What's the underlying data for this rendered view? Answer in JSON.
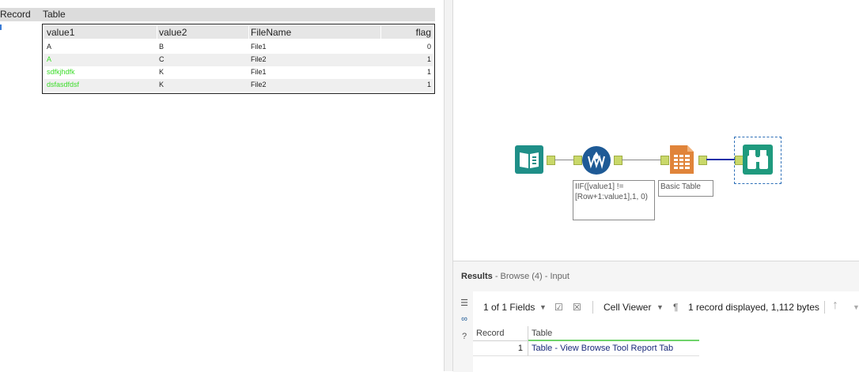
{
  "report": {
    "header": {
      "record": "Record",
      "table": "Table"
    },
    "columns": [
      "value1",
      "value2",
      "FileName",
      "flag"
    ],
    "rows": [
      {
        "value1": "A",
        "value2": "B",
        "filename": "File1",
        "flag": "0"
      },
      {
        "value1": "A",
        "value2": "C",
        "filename": "File2",
        "flag": "1"
      },
      {
        "value1": "sdfkjhdfk",
        "value2": "K",
        "filename": "File1",
        "flag": "1"
      },
      {
        "value1": "dsfasdfdsf",
        "value2": "K",
        "filename": "File2",
        "flag": "1"
      }
    ]
  },
  "workflow": {
    "formula_label": "IIF([value1] != [Row+1:value1],1, 0)",
    "table_label": "Basic Table",
    "tools": [
      "input-data-icon",
      "multi-row-formula-icon",
      "basic-table-icon",
      "browse-icon"
    ]
  },
  "results": {
    "title": "Results",
    "subtitle": "- Browse (4) - Input",
    "fields_label": "1 of 1 Fields",
    "cell_viewer_label": "Cell Viewer",
    "pilcrow": "¶",
    "status": "1 record displayed, 1,112 bytes",
    "grid": {
      "headers": {
        "record": "Record",
        "table": "Table"
      },
      "row": {
        "record": "1",
        "table": "Table - View Browse Tool Report Tab"
      }
    }
  },
  "colors": {
    "green_text": "#3cdc2a",
    "tool_teal": "#1f8f88",
    "tool_blue": "#1e5a96",
    "tool_orange": "#e0843a",
    "connector_blue": "#1a2fa8"
  }
}
